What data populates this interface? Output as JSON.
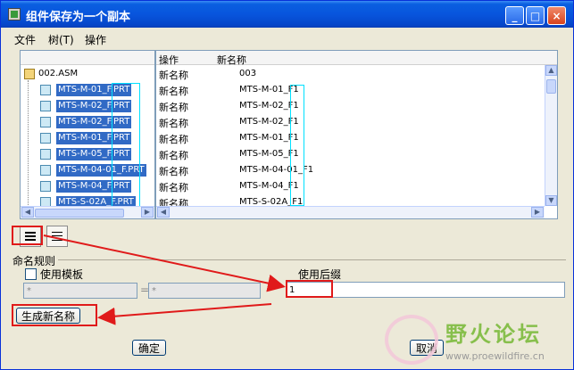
{
  "window": {
    "title": "组件保存为一个副本"
  },
  "menu": [
    {
      "label": "文件"
    },
    {
      "label": "树(T)"
    },
    {
      "label": "操作"
    }
  ],
  "tree": {
    "root": "002.ASM",
    "items": [
      {
        "label": "MTS-M-01_F.PRT"
      },
      {
        "label": "MTS-M-02_F.PRT"
      },
      {
        "label": "MTS-M-02_F.PRT"
      },
      {
        "label": "MTS-M-01_F.PRT"
      },
      {
        "label": "MTS-M-05_F.PRT"
      },
      {
        "label": "MTS-M-04-01_F.PRT"
      },
      {
        "label": "MTS-M-04_F.PRT"
      },
      {
        "label": "MTS-S-02A_F.PRT"
      }
    ]
  },
  "grid": {
    "headers": {
      "operation": "操作",
      "new_name": "新名称"
    },
    "rows": [
      {
        "op": "新名称",
        "name": "003"
      },
      {
        "op": "新名称",
        "name": "MTS-M-01_F1"
      },
      {
        "op": "新名称",
        "name": "MTS-M-02_F1"
      },
      {
        "op": "新名称",
        "name": "MTS-M-02_F1"
      },
      {
        "op": "新名称",
        "name": "MTS-M-01_F1"
      },
      {
        "op": "新名称",
        "name": "MTS-M-05_F1"
      },
      {
        "op": "新名称",
        "name": "MTS-M-04-01_F1"
      },
      {
        "op": "新名称",
        "name": "MTS-M-04_F1"
      },
      {
        "op": "新名称",
        "name": "MTS-S-02A_F1"
      }
    ]
  },
  "naming": {
    "group_label": "命名规则",
    "use_template_label": "使用模板",
    "template_field_1": "*",
    "equals_sign": "=",
    "template_field_2": "*",
    "use_suffix_label": "使用后缀",
    "suffix_value": "1",
    "generate_button": "生成新名称"
  },
  "buttons": {
    "ok": "确定",
    "cancel": "取消"
  },
  "watermark": {
    "title": "野火论坛",
    "url": "www.proewildfire.cn"
  },
  "colors": {
    "selection": "#316ac5",
    "annotation_red": "#e01a1a",
    "annotation_cyan": "#00e0ff",
    "titlebar": "#0855dd"
  }
}
